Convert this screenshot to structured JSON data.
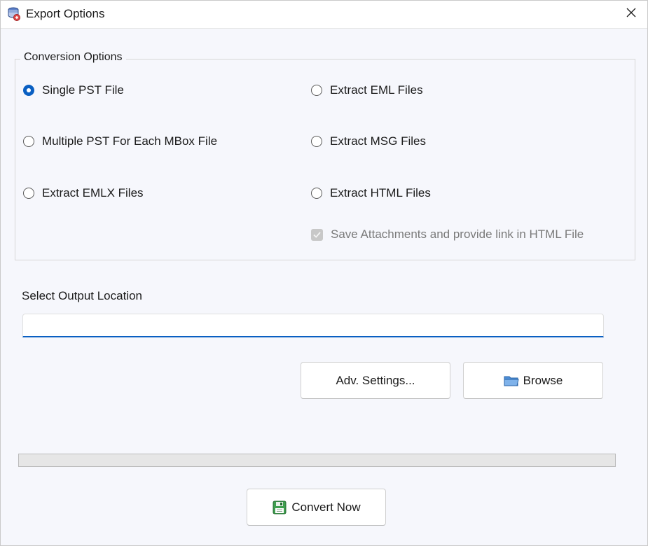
{
  "window": {
    "title": "Export Options",
    "icons": {
      "app": "app-database-icon",
      "close": "close-icon"
    }
  },
  "conversion": {
    "group_title": "Conversion Options",
    "options": [
      {
        "label": "Single PST File",
        "selected": true
      },
      {
        "label": "Multiple PST For Each MBox File",
        "selected": false
      },
      {
        "label": "Extract EMLX Files",
        "selected": false
      },
      {
        "label": "Extract EML Files",
        "selected": false
      },
      {
        "label": "Extract MSG Files",
        "selected": false
      },
      {
        "label": "Extract HTML Files",
        "selected": false
      }
    ],
    "save_attachments": {
      "label": "Save Attachments and provide link in HTML File",
      "checked": true,
      "disabled": true
    }
  },
  "output": {
    "label": "Select Output Location",
    "value": "",
    "placeholder": ""
  },
  "buttons": {
    "adv_settings": "Adv. Settings...",
    "browse": {
      "label": "Browse",
      "icon": "folder-icon"
    },
    "convert": {
      "label": "Convert Now",
      "icon": "save-disk-icon"
    }
  },
  "progress": {
    "value": 0
  },
  "colors": {
    "accent": "#0a5fc2",
    "window_bg": "#f6f7fc",
    "disabled_text": "#7a7a7a"
  }
}
